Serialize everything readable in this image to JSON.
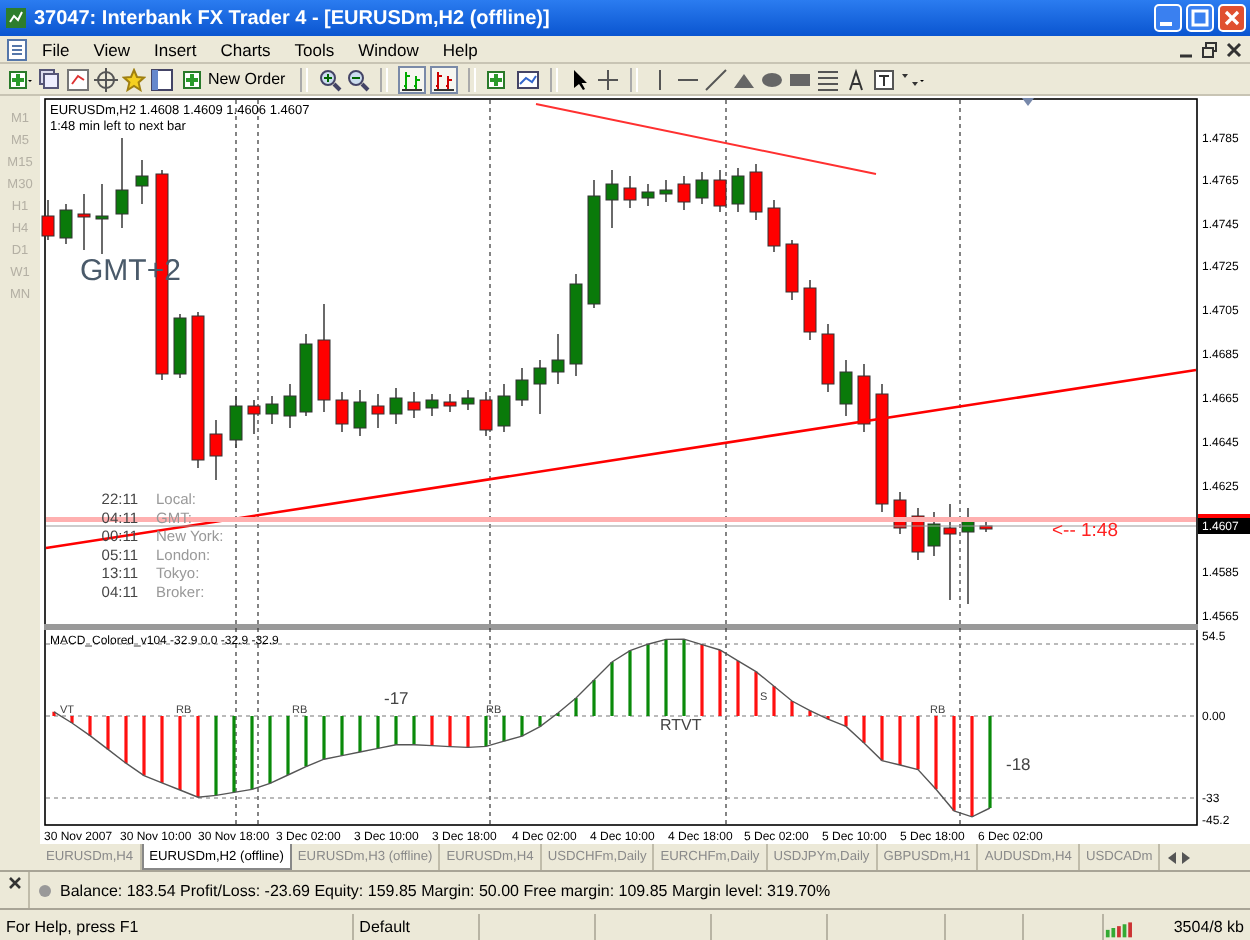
{
  "window": {
    "title": "37047: Interbank FX Trader 4 - [EURUSDm,H2 (offline)]"
  },
  "menu": [
    "File",
    "View",
    "Insert",
    "Charts",
    "Tools",
    "Window",
    "Help"
  ],
  "toolbar": {
    "new_order": "New Order"
  },
  "timeframes": [
    {
      "label": "M1",
      "disabled": true
    },
    {
      "label": "M5",
      "disabled": true
    },
    {
      "label": "M15",
      "disabled": true
    },
    {
      "label": "M30",
      "disabled": true
    },
    {
      "label": "H1",
      "disabled": true
    },
    {
      "label": "H4",
      "disabled": true
    },
    {
      "label": "D1",
      "disabled": true
    },
    {
      "label": "W1",
      "disabled": true
    },
    {
      "label": "MN",
      "disabled": true
    }
  ],
  "chart": {
    "header": "EURUSDm,H2  1.4608 1.4609 1.4606 1.4607",
    "countdown": "1:48 min left to next bar",
    "timezone": "GMT+2",
    "clocks": [
      {
        "time": "22:11",
        "place": "Local:"
      },
      {
        "time": "04:11",
        "place": "GMT:"
      },
      {
        "time": "00:11",
        "place": "New York:"
      },
      {
        "time": "05:11",
        "place": "London:"
      },
      {
        "time": "13:11",
        "place": "Tokyo:"
      },
      {
        "time": "04:11",
        "place": "Broker:"
      }
    ],
    "price_axis": [
      "1.4785",
      "1.4765",
      "1.4745",
      "1.4725",
      "1.4705",
      "1.4685",
      "1.4665",
      "1.4645",
      "1.4625",
      "1.4585",
      "1.4565"
    ],
    "current_price": "1.4607",
    "bar_timer": "<-- 1:48",
    "indicator": {
      "title": "MACD_Colored_v104 -32.9 0.0 -32.9 -32.9",
      "axis": [
        "54.5",
        "0.00",
        "-33",
        "-45.2"
      ],
      "labels": [
        "VT",
        "RB",
        "RB",
        "RB",
        "-17",
        "RTVT",
        "S",
        "RB",
        "-18"
      ]
    },
    "time_axis": [
      "30 Nov 2007",
      "30 Nov 10:00",
      "30 Nov 18:00",
      "3 Dec 02:00",
      "3 Dec 10:00",
      "3 Dec 18:00",
      "4 Dec 02:00",
      "4 Dec 10:00",
      "4 Dec 18:00",
      "5 Dec 02:00",
      "5 Dec 10:00",
      "5 Dec 18:00",
      "6 Dec 02:00"
    ]
  },
  "tabs": [
    {
      "label": "EURUSDm,H4",
      "selected": false
    },
    {
      "label": "EURUSDm,H2 (offline)",
      "selected": true
    },
    {
      "label": "EURUSDm,H3 (offline)",
      "selected": false
    },
    {
      "label": "EURUSDm,H4",
      "selected": false
    },
    {
      "label": "USDCHFm,Daily",
      "selected": false
    },
    {
      "label": "EURCHFm,Daily",
      "selected": false
    },
    {
      "label": "USDJPYm,Daily",
      "selected": false
    },
    {
      "label": "GBPUSDm,H1",
      "selected": false
    },
    {
      "label": "AUDUSDm,H4",
      "selected": false
    },
    {
      "label": "USDCADm",
      "selected": false
    }
  ],
  "terminal": {
    "summary": "Balance: 183.54  Profit/Loss: -23.69  Equity: 159.85  Margin: 50.00  Free margin: 109.85  Margin level: 319.70%"
  },
  "status_bar": [
    "For Help, press F1",
    "Default",
    "3504/8 kb"
  ]
}
